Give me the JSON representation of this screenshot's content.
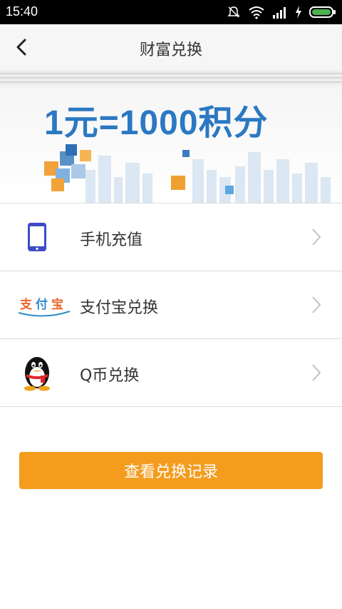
{
  "status_bar": {
    "time": "15:40"
  },
  "header": {
    "title": "财富兑换"
  },
  "banner": {
    "headline": "1元=1000积分"
  },
  "list": [
    {
      "label": "手机充值",
      "icon": "phone-icon"
    },
    {
      "label": "支付宝兑换",
      "icon": "alipay-logo"
    },
    {
      "label": "Q币兑换",
      "icon": "qq-penguin-icon"
    }
  ],
  "button": {
    "label": "查看兑换记录"
  },
  "colors": {
    "accent": "#f39c1e",
    "banner_text": "#2b78c3",
    "phone": "#3d4bc9"
  }
}
